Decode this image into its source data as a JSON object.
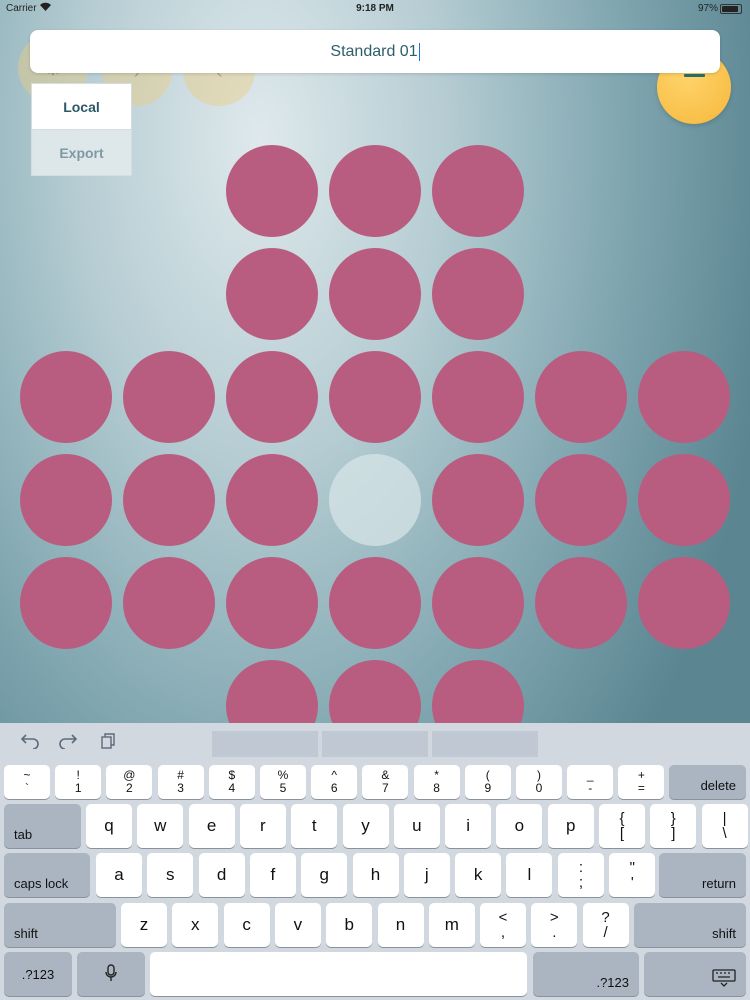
{
  "status_bar": {
    "carrier": "Carrier",
    "time": "9:18 PM",
    "battery_percent": "97%",
    "battery_level": 0.97
  },
  "title_field": {
    "value": "Standard 01"
  },
  "popup_menu": {
    "items": [
      {
        "label": "Local"
      },
      {
        "label": "Export"
      }
    ]
  },
  "board": {
    "peg_color": "#b95d80",
    "empty_color": "#d7e4e7",
    "rows": [
      [
        0,
        0,
        1,
        1,
        1,
        0,
        0
      ],
      [
        0,
        0,
        1,
        1,
        1,
        0,
        0
      ],
      [
        1,
        1,
        1,
        1,
        1,
        1,
        1
      ],
      [
        1,
        1,
        1,
        2,
        1,
        1,
        1
      ],
      [
        1,
        1,
        1,
        1,
        1,
        1,
        1
      ],
      [
        0,
        0,
        1,
        1,
        1,
        0,
        0
      ]
    ],
    "legend": "1 = peg, 2 = empty hole, 0 = none"
  },
  "toolbar": {
    "menu_icon": "menu-icon",
    "undo_icon": "undo-icon",
    "redo_icon": "redo-icon",
    "paste_icon": "paste-icon"
  },
  "keyboard": {
    "row1": [
      {
        "top": "~",
        "bottom": "`"
      },
      {
        "top": "!",
        "bottom": "1"
      },
      {
        "top": "@",
        "bottom": "2"
      },
      {
        "top": "#",
        "bottom": "3"
      },
      {
        "top": "$",
        "bottom": "4"
      },
      {
        "top": "%",
        "bottom": "5"
      },
      {
        "top": "^",
        "bottom": "6"
      },
      {
        "top": "&",
        "bottom": "7"
      },
      {
        "top": "*",
        "bottom": "8"
      },
      {
        "top": "(",
        "bottom": "9"
      },
      {
        "top": ")",
        "bottom": "0"
      },
      {
        "top": "_",
        "bottom": "-"
      },
      {
        "top": "+",
        "bottom": "="
      }
    ],
    "delete": "delete",
    "tab": "tab",
    "row2": [
      "q",
      "w",
      "e",
      "r",
      "t",
      "y",
      "u",
      "i",
      "o",
      "p"
    ],
    "row2_sym": [
      {
        "top": "{",
        "bottom": "["
      },
      {
        "top": "}",
        "bottom": "]"
      },
      {
        "top": "|",
        "bottom": "\\"
      }
    ],
    "caps_lock": "caps lock",
    "row3": [
      "a",
      "s",
      "d",
      "f",
      "g",
      "h",
      "j",
      "k",
      "l"
    ],
    "row3_sym": [
      {
        "top": ":",
        "bottom": ";"
      },
      {
        "top": "\"",
        "bottom": "'"
      }
    ],
    "return": "return",
    "shift": "shift",
    "row4": [
      "z",
      "x",
      "c",
      "v",
      "b",
      "n",
      "m"
    ],
    "row4_sym": [
      {
        "top": "<",
        "bottom": ","
      },
      {
        "top": ">",
        "bottom": "."
      },
      {
        "top": "?",
        "bottom": "/"
      }
    ],
    "num_mode": ".?123",
    "mic_icon": "microphone-icon",
    "hide_keyboard_icon": "keyboard-dismiss-icon"
  }
}
